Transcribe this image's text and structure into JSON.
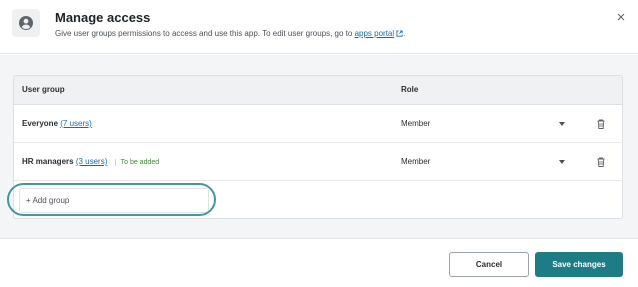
{
  "dialog": {
    "title": "Manage access",
    "subtitle_prefix": "Give user groups permissions to access and use this app. To edit user groups, go to ",
    "subtitle_link": "apps portal",
    "subtitle_suffix": "."
  },
  "table": {
    "columns": {
      "group": "User group",
      "role": "Role"
    },
    "rows": [
      {
        "name": "Everyone",
        "users_link": "(7 users)",
        "badge": "",
        "role": "Member"
      },
      {
        "name": "HR managers",
        "users_link": "(3 users)",
        "badge": "To be added",
        "role": "Member"
      }
    ],
    "add_group_placeholder": "+ Add group"
  },
  "footer": {
    "cancel_label": "Cancel",
    "save_label": "Save changes"
  },
  "colors": {
    "accent": "#1e7c85",
    "focus_ring": "#3e9a9a",
    "link": "#1a6aa8",
    "badge_text": "#3d8a2e"
  },
  "icons": [
    "user-circle-icon",
    "external-link-icon",
    "close-icon",
    "caret-down-icon",
    "trash-icon"
  ]
}
